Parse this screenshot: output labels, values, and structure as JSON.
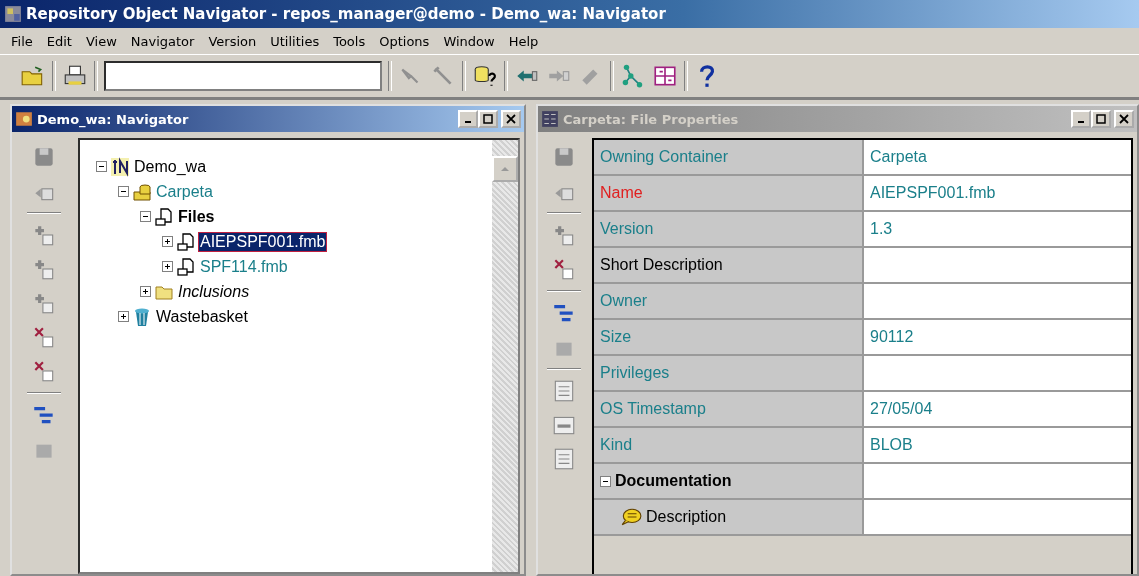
{
  "window": {
    "title": "Repository Object Navigator - repos_manager@demo - Demo_wa: Navigator"
  },
  "menu": [
    "File",
    "Edit",
    "View",
    "Navigator",
    "Version",
    "Utilities",
    "Tools",
    "Options",
    "Window",
    "Help"
  ],
  "navigator": {
    "title": "Demo_wa: Navigator",
    "active": true,
    "tree": [
      {
        "label": "Demo_wa",
        "kind": "workarea",
        "expanded": true,
        "selected": false,
        "children": [
          {
            "label": "Carpeta",
            "kind": "container",
            "expanded": true,
            "selected": false,
            "children": [
              {
                "label": "Files",
                "kind": "group",
                "expanded": true,
                "selected": false,
                "children": [
                  {
                    "label": "AIEPSPF001.fmb",
                    "kind": "file",
                    "expanded": false,
                    "selected": true
                  },
                  {
                    "label": "SPF114.fmb",
                    "kind": "file",
                    "expanded": false,
                    "selected": false
                  }
                ]
              },
              {
                "label": "Inclusions",
                "kind": "folder",
                "expanded": false,
                "selected": false
              }
            ]
          },
          {
            "label": "Wastebasket",
            "kind": "wastebasket",
            "expanded": false,
            "selected": false
          }
        ]
      }
    ]
  },
  "properties": {
    "title": "Carpeta: File Properties",
    "active": false,
    "rows": [
      {
        "label": "Owning Container",
        "value": "Carpeta",
        "color": "#1a7f8a"
      },
      {
        "label": "Name",
        "value": "AIEPSPF001.fmb",
        "color": "#e02020"
      },
      {
        "label": "Version",
        "value": "1.3",
        "color": "#1a7f8a"
      },
      {
        "label": "Short Description",
        "color": "#000000"
      },
      {
        "label": "Owner",
        "color": "#1a7f8a"
      },
      {
        "label": "Size",
        "value": "90112",
        "color": "#1a7f8a"
      },
      {
        "label": "Privileges",
        "color": "#1a7f8a"
      },
      {
        "label": "OS Timestamp",
        "value": "27/05/04",
        "color": "#1a7f8a"
      },
      {
        "label": "Kind",
        "value": "BLOB",
        "color": "#1a7f8a"
      },
      {
        "label": "Documentation",
        "color": "#000000",
        "expanded": true,
        "children": [
          {
            "label": "Description",
            "color": "#000000"
          }
        ]
      }
    ]
  }
}
